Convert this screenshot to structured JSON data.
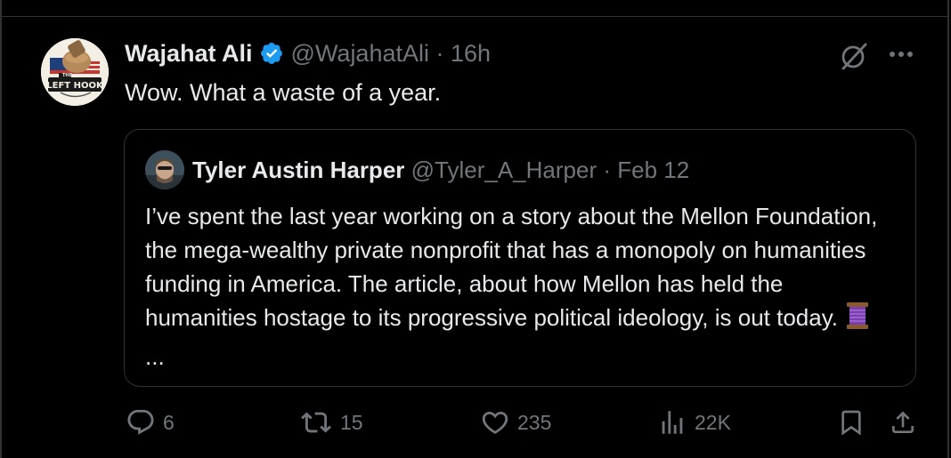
{
  "tweet": {
    "author_name": "Wajahat Ali",
    "handle": "@WajahatAli",
    "time": "· 16h",
    "text": "Wow. What a waste of a year.",
    "avatar_logo_text": "THE LEFT HOOK",
    "verified_icon": "verified-badge-icon",
    "colors": {
      "verified": "#1d9bf0",
      "muted": "#71767b",
      "text": "#e7e9ea",
      "border": "#2f3336"
    }
  },
  "quote": {
    "author_name": "Tyler Austin Harper",
    "handle": "@Tyler_A_Harper",
    "time": "· Feb 12",
    "text": "I’ve spent the last year working on a story about the Mellon Foundation, the mega-wealthy private nonprofit that has a monopoly on humanities funding in America. The article, about how Mellon has held the humanities hostage to its progressive political ideology, is out today.",
    "emoji": "thread-emoji",
    "ellipsis": "..."
  },
  "actions": {
    "reply_count": "6",
    "retweet_count": "15",
    "like_count": "235",
    "view_count": "22K"
  }
}
